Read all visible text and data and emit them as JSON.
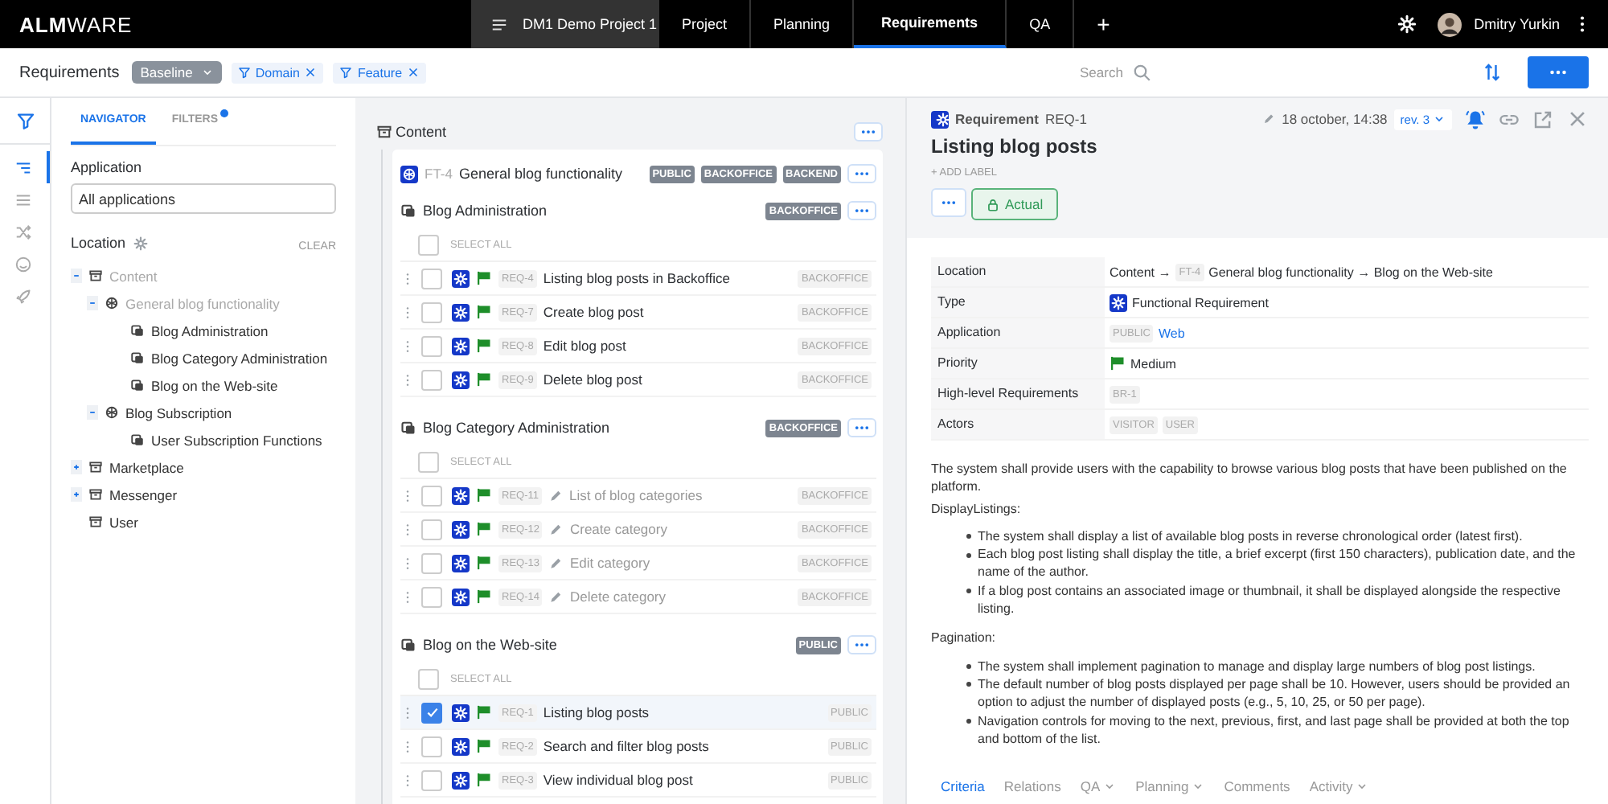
{
  "brand": {
    "strong": "ALM",
    "light": "WARE"
  },
  "top_tabs": [
    {
      "label": "DM1 Demo Project 1",
      "kind": "project",
      "selected": false
    },
    {
      "label": "Project",
      "kind": "tab",
      "selected": false
    },
    {
      "label": "Planning",
      "kind": "tab",
      "selected": false
    },
    {
      "label": "Requirements",
      "kind": "tab",
      "selected": true
    },
    {
      "label": "QA",
      "kind": "tab",
      "selected": false
    },
    {
      "label": "+",
      "kind": "add",
      "selected": false
    }
  ],
  "user": {
    "name": "Dmitry Yurkin"
  },
  "toolbar": {
    "title": "Requirements",
    "baseline": "Baseline",
    "filters": [
      "Domain",
      "Feature"
    ],
    "search_placeholder": "Search"
  },
  "rail": [
    {
      "kind": "tree",
      "selected": true
    },
    {
      "kind": "list",
      "selected": false
    },
    {
      "kind": "shuffle",
      "selected": false
    },
    {
      "kind": "smile",
      "selected": false
    },
    {
      "kind": "rocket",
      "selected": false
    }
  ],
  "navigator": {
    "tabs": [
      {
        "label": "NAVIGATOR",
        "selected": true,
        "notify": false
      },
      {
        "label": "FILTERS",
        "selected": false,
        "notify": true
      }
    ],
    "application_label": "Application",
    "application_value": "All applications",
    "location_label": "Location",
    "clear": "CLEAR",
    "tree": [
      {
        "label": "Content",
        "kind": "folder",
        "expanded": true,
        "muted": true,
        "children": [
          {
            "label": "General blog functionality",
            "kind": "feature",
            "expanded": true,
            "muted": true,
            "children": [
              {
                "label": "Blog Administration",
                "kind": "group",
                "muted": false
              },
              {
                "label": "Blog Category Administration",
                "kind": "group",
                "muted": false
              },
              {
                "label": "Blog on the Web-site",
                "kind": "group",
                "muted": false
              }
            ]
          },
          {
            "label": "Blog Subscription",
            "kind": "feature",
            "expanded": true,
            "muted": false,
            "children": [
              {
                "label": "User Subscription Functions",
                "kind": "group",
                "muted": false
              }
            ]
          }
        ]
      },
      {
        "label": "Marketplace",
        "kind": "folder",
        "expanded": false,
        "muted": false
      },
      {
        "label": "Messenger",
        "kind": "folder",
        "expanded": false,
        "muted": false
      },
      {
        "label": "User",
        "kind": "folder",
        "muted": false
      }
    ]
  },
  "content": {
    "title": "Content",
    "feature": {
      "id": "FT-4",
      "title": "General blog functionality",
      "tags": [
        "PUBLIC",
        "BACKOFFICE",
        "BACKEND"
      ]
    },
    "groups": [
      {
        "title": "Blog Administration",
        "tag": "BACKOFFICE",
        "select_all": "SELECT ALL",
        "select_all_checked": false,
        "items": [
          {
            "id": "REQ-4",
            "title": "Listing blog posts in Backoffice",
            "tag": "BACKOFFICE",
            "draft": false,
            "checked": false
          },
          {
            "id": "REQ-7",
            "title": "Create blog post",
            "tag": "BACKOFFICE",
            "draft": false,
            "checked": false
          },
          {
            "id": "REQ-8",
            "title": "Edit blog post",
            "tag": "BACKOFFICE",
            "draft": false,
            "checked": false
          },
          {
            "id": "REQ-9",
            "title": "Delete blog post",
            "tag": "BACKOFFICE",
            "draft": false,
            "checked": false
          }
        ]
      },
      {
        "title": "Blog Category Administration",
        "tag": "BACKOFFICE",
        "select_all": "SELECT ALL",
        "select_all_checked": false,
        "items": [
          {
            "id": "REQ-11",
            "title": "List of blog categories",
            "tag": "BACKOFFICE",
            "draft": true,
            "checked": false
          },
          {
            "id": "REQ-12",
            "title": "Create category",
            "tag": "BACKOFFICE",
            "draft": true,
            "checked": false
          },
          {
            "id": "REQ-13",
            "title": "Edit category",
            "tag": "BACKOFFICE",
            "draft": true,
            "checked": false
          },
          {
            "id": "REQ-14",
            "title": "Delete category",
            "tag": "BACKOFFICE",
            "draft": true,
            "checked": false
          }
        ]
      },
      {
        "title": "Blog on the Web-site",
        "tag": "PUBLIC",
        "select_all": "SELECT ALL",
        "select_all_checked": false,
        "items": [
          {
            "id": "REQ-1",
            "title": "Listing blog posts",
            "tag": "PUBLIC",
            "draft": false,
            "checked": true
          },
          {
            "id": "REQ-2",
            "title": "Search and filter blog posts",
            "tag": "PUBLIC",
            "draft": false,
            "checked": false
          },
          {
            "id": "REQ-3",
            "title": "View individual blog post",
            "tag": "PUBLIC",
            "draft": false,
            "checked": false
          }
        ]
      }
    ]
  },
  "detail": {
    "type": "Requirement",
    "id": "REQ-1",
    "edited": "18 october, 14:38",
    "revision": "rev. 3",
    "title": "Listing blog posts",
    "add_label": "+ ADD LABEL",
    "status": "Actual",
    "properties": [
      {
        "label": "Location",
        "value": [
          {
            "kind": "text",
            "text": "Content →"
          },
          {
            "kind": "chip",
            "text": "FT-4"
          },
          {
            "kind": "text",
            "text": "General blog functionality → Blog on the Web-site"
          }
        ]
      },
      {
        "label": "Type",
        "value": [
          {
            "kind": "type_icon"
          },
          {
            "kind": "text",
            "text": "Functional Requirement"
          }
        ]
      },
      {
        "label": "Application",
        "value": [
          {
            "kind": "chip",
            "text": "PUBLIC"
          },
          {
            "kind": "link",
            "text": "Web"
          }
        ]
      },
      {
        "label": "Priority",
        "value": [
          {
            "kind": "flag"
          },
          {
            "kind": "text",
            "text": "Medium"
          }
        ]
      },
      {
        "label": "High-level Requirements",
        "value": [
          {
            "kind": "chip",
            "text": "BR-1"
          }
        ]
      },
      {
        "label": "Actors",
        "value": [
          {
            "kind": "chip",
            "text": "VISITOR"
          },
          {
            "kind": "chip",
            "text": "USER"
          }
        ]
      }
    ],
    "description": [
      {
        "kind": "p",
        "text": "The system shall provide users with the capability to browse various blog posts that have been published on the platform."
      },
      {
        "kind": "p",
        "text": "DisplayListings:"
      },
      {
        "kind": "list",
        "items": [
          "The system shall display a list of available blog posts in reverse chronological order (latest first).",
          "Each blog post listing shall display the title, a brief excerpt (first 150 characters), publication date, and the name of the author.",
          "If a blog post contains an associated image or thumbnail, it shall be displayed alongside the respective listing."
        ]
      },
      {
        "kind": "p",
        "text": "Pagination:"
      },
      {
        "kind": "list",
        "items": [
          "The system shall implement pagination to manage and display large numbers of blog post listings.",
          "The default number of blog posts displayed per page shall be 10. However, users should be provided an option to adjust the number of displayed posts (e.g., 5, 10, 25, or 50 per page).",
          "Navigation controls for moving to the next, previous, first, and last page shall be provided at both the top and bottom of the list."
        ]
      }
    ],
    "tabs": [
      {
        "label": "Criteria",
        "selected": true,
        "dropdown": false
      },
      {
        "label": "Relations",
        "selected": false,
        "dropdown": false
      },
      {
        "label": "QA",
        "selected": false,
        "dropdown": true
      },
      {
        "label": "Planning",
        "selected": false,
        "dropdown": true
      },
      {
        "label": "Comments",
        "selected": false,
        "dropdown": false
      },
      {
        "label": "Activity",
        "selected": false,
        "dropdown": true
      }
    ]
  }
}
